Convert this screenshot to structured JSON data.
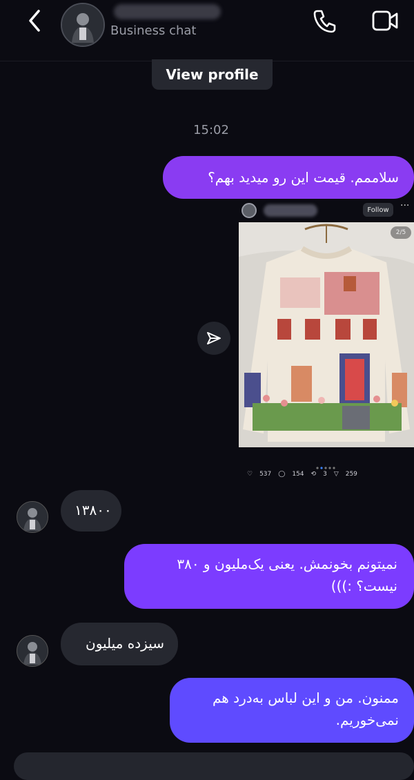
{
  "header": {
    "subtitle": "Business chat",
    "icons": [
      "back-chevron-icon",
      "phone-icon",
      "video-camera-icon"
    ]
  },
  "view_profile_label": "View profile",
  "timestamp": "15:02",
  "messages": {
    "m1": "سلاممم. قیمت این رو میدید بهم؟",
    "m2": "۱۳۸۰۰",
    "m3": "نمیتونم بخونمش. یعنی یک‌ملیون و ۳۸۰ نیست؟ :)))",
    "m4": "سیزده میلیون",
    "m5": "ممنون. من و این لباس به‌درد هم نمی‌خوریم."
  },
  "post": {
    "follow_label": "Follow",
    "more_label": "···",
    "image_counter": "2/5",
    "likes": "537",
    "comments": "154",
    "reposts": "3",
    "shares": "259"
  },
  "colors": {
    "background": "#0b0b12",
    "outgoing_bubble": "#7c3cff",
    "incoming_bubble": "#262830"
  }
}
